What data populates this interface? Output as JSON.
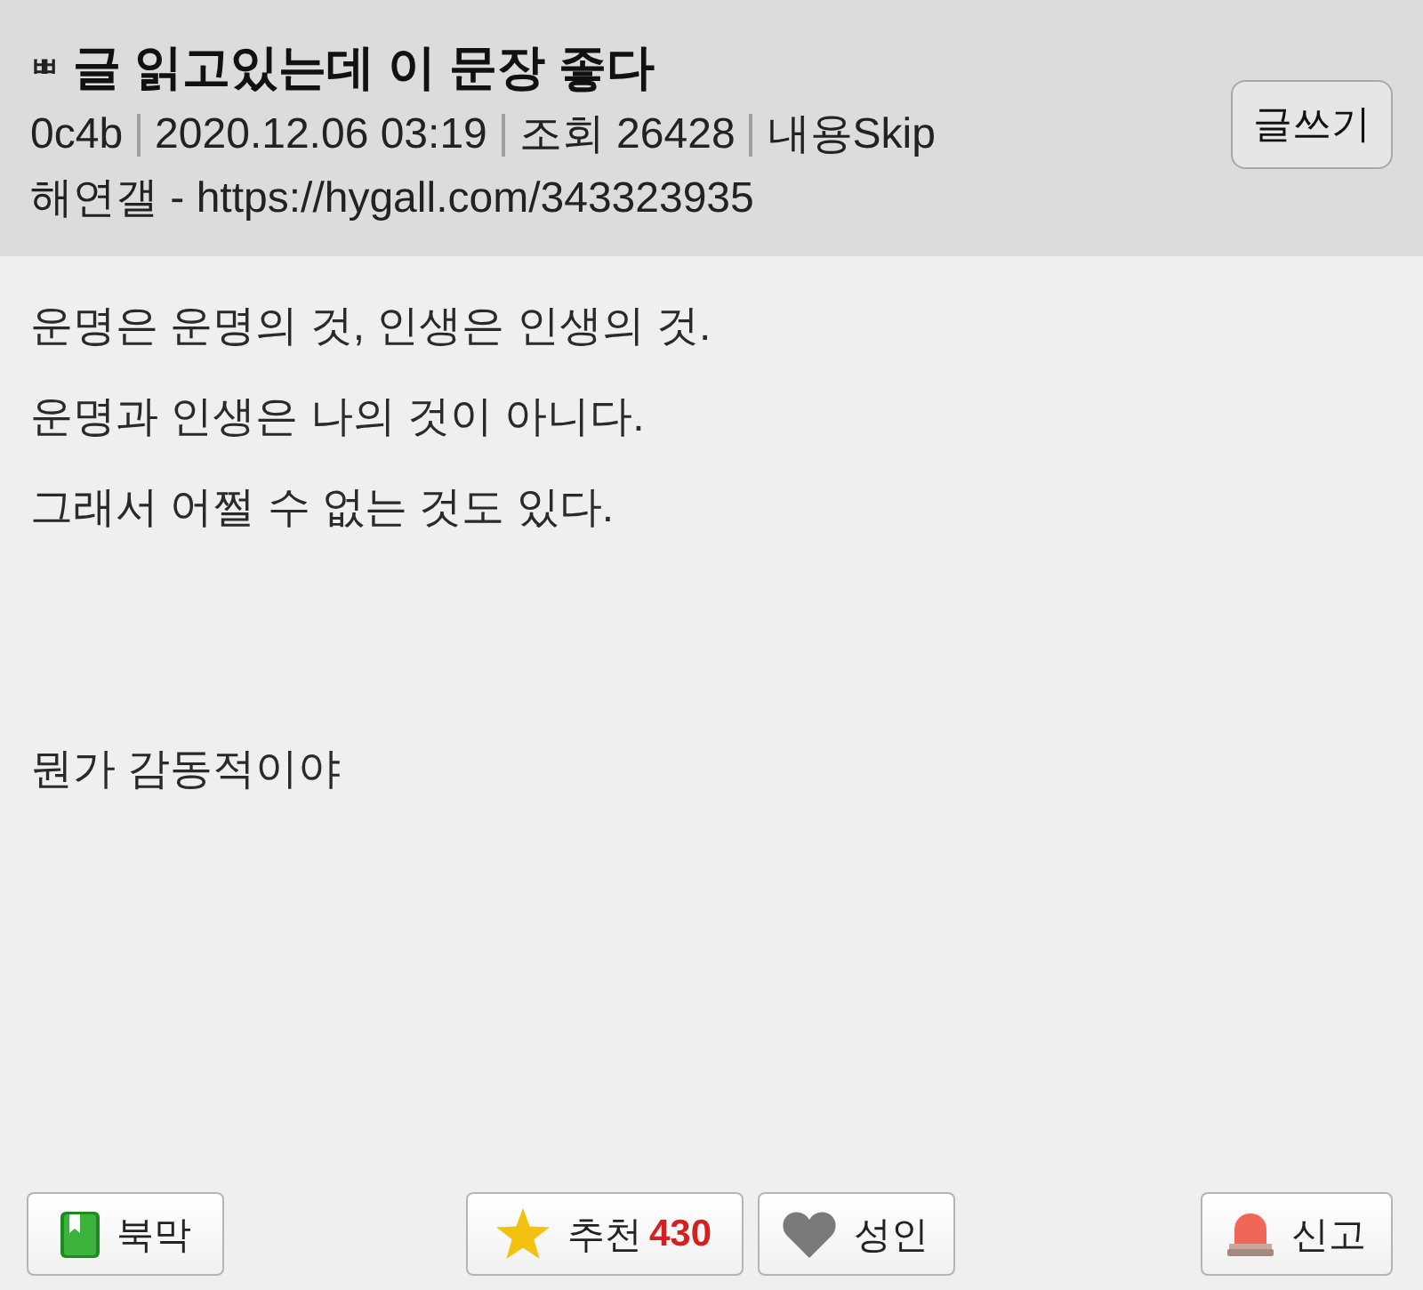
{
  "header": {
    "tag": "ㅃ",
    "title": "글 읽고있는데 이 문장 좋다",
    "meta": [
      "0c4b",
      "2020.12.06 03:19",
      "조회 26428",
      "내용Skip"
    ],
    "source": "해연갤 - https://hygall.com/343323935",
    "write_button": "글쓰기"
  },
  "body": {
    "paragraphs": [
      [
        "운명은 운명의 것, 인생은 인생의 것.",
        "운명과 인생은 나의 것이 아니다.",
        "그래서 어쩔 수 없는 것도 있다."
      ],
      [
        "뭔가 감동적이야"
      ]
    ]
  },
  "footer": {
    "left": [
      {
        "kind": "bookmark",
        "label": "북막"
      }
    ],
    "center": [
      {
        "kind": "recommend",
        "label": "추천",
        "count": "430"
      },
      {
        "kind": "adult",
        "label": "성인"
      }
    ],
    "right": [
      {
        "kind": "report",
        "label": "신고"
      }
    ]
  }
}
